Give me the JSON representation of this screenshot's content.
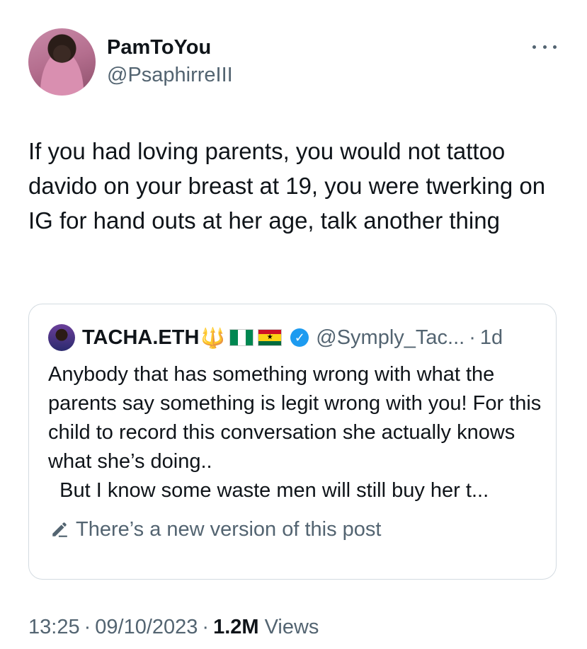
{
  "author": {
    "display_name": "PamToYou",
    "handle": "@PsaphirreIII"
  },
  "tweet": {
    "text": "If you had loving parents, you would not tattoo davido on your breast at 19, you were twerking on IG for hand outs at her age, talk another thing"
  },
  "quoted": {
    "display_name": "TACHA.ETH",
    "name_emoji": "🔱",
    "flags": [
      "nigeria-flag",
      "ghana-flag"
    ],
    "handle": "@Symply_Tac...",
    "separator": "·",
    "time": "1d",
    "text": "Anybody that has something wrong with what the parents say something is legit wrong with you! For this child to record this conversation she actually knows what she’s doing..\n  But I know some waste men will still buy her t...",
    "edit_notice": "There’s a new version of this post"
  },
  "meta": {
    "time": "13:25",
    "separator": "·",
    "date": "09/10/2023",
    "separator2": "·",
    "views_count": "1.2M",
    "views_label": "Views"
  },
  "colors": {
    "text_primary": "#0f1419",
    "text_secondary": "#536471",
    "verified_blue": "#1d9bf0",
    "card_border": "#d3dbe1"
  }
}
